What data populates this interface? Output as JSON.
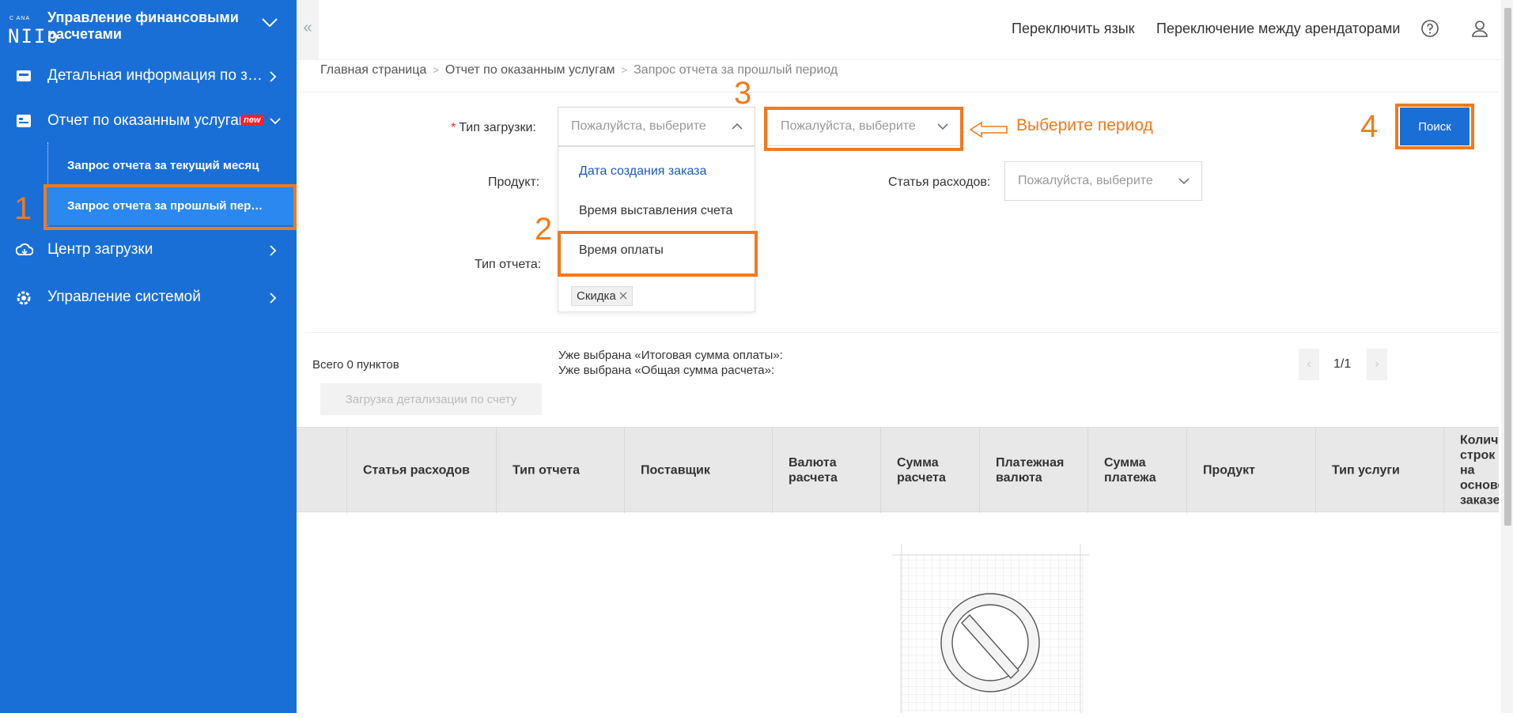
{
  "app": {
    "logo_small": "C ANA",
    "logo_text": "NIIo",
    "title": "Управление финансовыми расчетами"
  },
  "sidebar": {
    "items": [
      {
        "label": "Детальная информация по заказу",
        "icon": "box-icon"
      },
      {
        "label": "Отчет по оказанным услугам",
        "icon": "report-icon",
        "badge": "new"
      },
      {
        "label": "Центр загрузки",
        "icon": "cloud-icon"
      },
      {
        "label": "Управление системой",
        "icon": "gear-icon"
      }
    ],
    "subitems": [
      {
        "label": "Запрос отчета за текущий месяц"
      },
      {
        "label": "Запрос отчета за прошлый период",
        "active": true
      }
    ]
  },
  "topbar": {
    "switch_language": "Переключить язык",
    "switch_tenant": "Переключение между арендаторами"
  },
  "breadcrumb": [
    "Главная страница",
    "Отчет по оказанным услугам",
    "Запрос отчета за прошлый период"
  ],
  "form": {
    "download_type_label": "Тип загрузки",
    "product_label": "Продукт",
    "report_type_label": "Тип отчета",
    "expense_item_label": "Статья расходов",
    "colon": ":",
    "required_mark": "*",
    "placeholder": "Пожалуйста, выберите",
    "dropdown_options": [
      "Дата создания заказа",
      "Время выставления счета",
      "Время оплаты"
    ],
    "selected_tag": "Скидка",
    "search_button": "Поиск"
  },
  "annotations": {
    "step1": "1",
    "step2": "2",
    "step3": "3",
    "step4": "4",
    "hint": "Выберите период",
    "color": "#f07a1e"
  },
  "results": {
    "total": "Всего 0 пунктов",
    "info_1": "Уже выбрана «Итоговая сумма оплаты»:",
    "info_2": "Уже выбрана «Общая сумма расчета»:",
    "download_button": "Загрузка детализации по счету",
    "pager": "1/1"
  },
  "table": {
    "columns": [
      "Статья расходов",
      "Тип отчета",
      "Поставщик",
      "Валюта расчета",
      "Сумма расчета",
      "Платежная валюта",
      "Сумма платежа",
      "Продукт",
      "Тип услуги",
      "Количество строк на основе заказе"
    ]
  },
  "colors": {
    "sidebar": "#1a6fd6",
    "accent": "#1a6fd6",
    "annotation": "#f07a1e",
    "danger": "#f5222d"
  }
}
